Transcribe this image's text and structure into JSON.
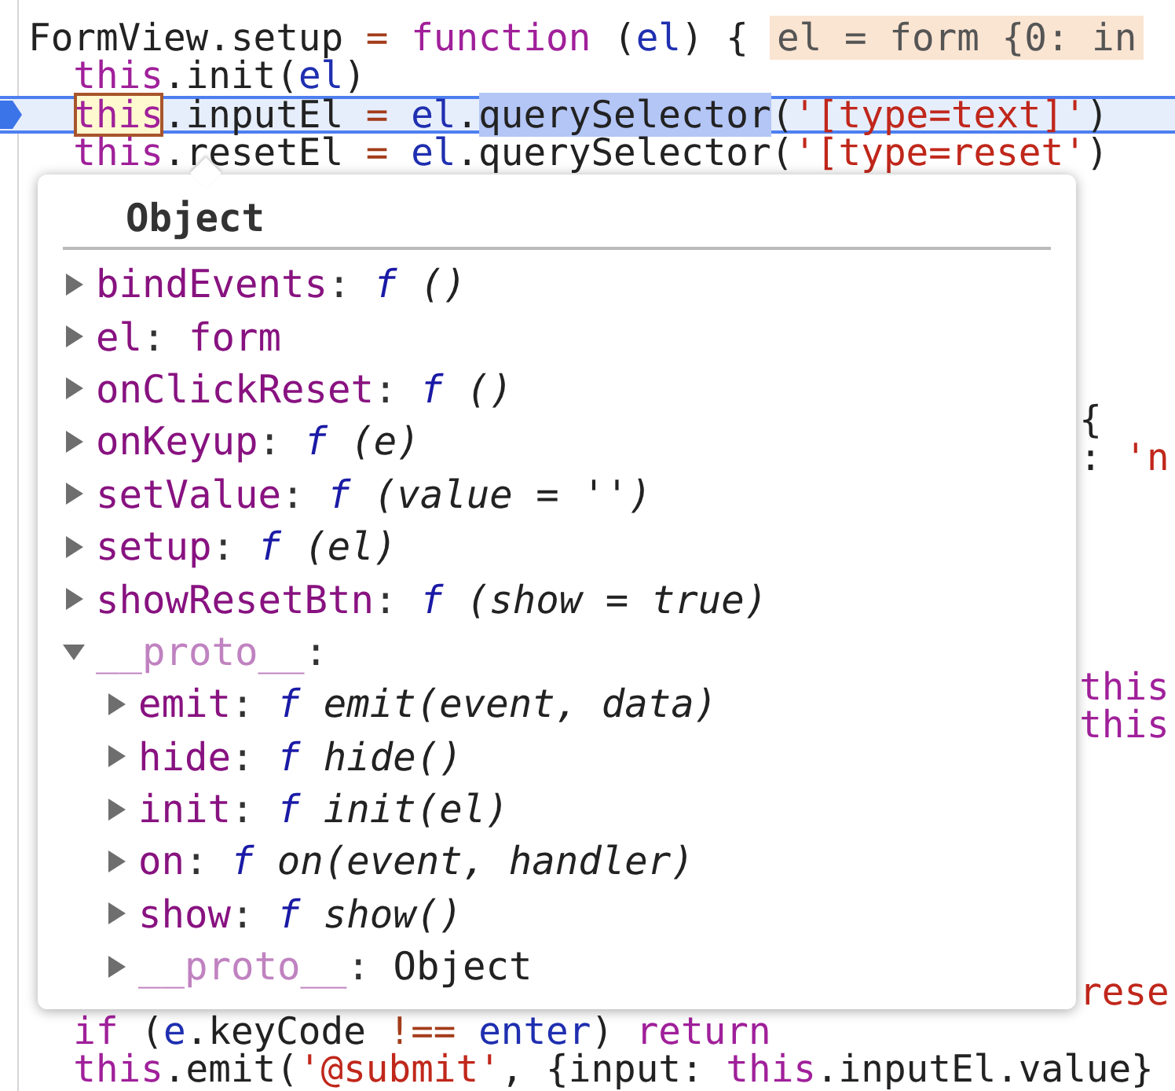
{
  "code_lines": [
    {
      "paused": false,
      "tokens": [
        {
          "kind": "plain",
          "text": "FormView.setup "
        },
        {
          "kind": "operator",
          "text": "= "
        },
        {
          "kind": "keyword",
          "text": "function"
        },
        {
          "kind": "plain",
          "text": " ("
        },
        {
          "kind": "variable",
          "text": "el"
        },
        {
          "kind": "plain",
          "text": ") {"
        }
      ],
      "inline_value": "el = form {0: in"
    },
    {
      "paused": false,
      "tokens": [
        {
          "kind": "keyword",
          "text": "  this"
        },
        {
          "kind": "plain",
          "text": ".init("
        },
        {
          "kind": "variable",
          "text": "el"
        },
        {
          "kind": "plain",
          "text": ")"
        }
      ]
    },
    {
      "paused": true,
      "tokens": [
        {
          "kind": "keyword",
          "text": "  this",
          "hovered": true,
          "selected": false
        },
        {
          "kind": "plain",
          "text": ".inputEl ",
          "hovered": false,
          "selected": false
        },
        {
          "kind": "operator",
          "text": "= ",
          "hovered": false,
          "selected": false
        },
        {
          "kind": "variable",
          "text": "el",
          "hovered": false,
          "selected": false
        },
        {
          "kind": "plain",
          "text": ".",
          "hovered": false,
          "selected": false
        },
        {
          "kind": "plain",
          "text": "querySelector",
          "hovered": false,
          "selected": true
        },
        {
          "kind": "plain",
          "text": "(",
          "hovered": false,
          "selected": false
        },
        {
          "kind": "string",
          "text": "'[type=text]'",
          "hovered": false,
          "selected": false
        },
        {
          "kind": "plain",
          "text": ")",
          "hovered": false,
          "selected": false
        }
      ]
    },
    {
      "paused": false,
      "tokens": [
        {
          "kind": "keyword",
          "text": "  this"
        },
        {
          "kind": "plain",
          "text": ".resetEl "
        },
        {
          "kind": "operator",
          "text": "= "
        },
        {
          "kind": "variable",
          "text": "el"
        },
        {
          "kind": "plain",
          "text": ".querySelector("
        },
        {
          "kind": "string",
          "text": "'[type=reset'"
        },
        {
          "kind": "plain",
          "text": ")"
        }
      ]
    },
    {
      "paused": false
    },
    {
      "paused": false
    },
    {
      "paused": false
    },
    {
      "paused": false
    },
    {
      "paused": false
    },
    {
      "paused": false
    },
    {
      "paused": false,
      "right": [
        {
          "kind": "plain",
          "text": "{"
        }
      ]
    },
    {
      "paused": false,
      "right": [
        {
          "kind": "plain",
          "text": ": "
        },
        {
          "kind": "string",
          "text": "'n"
        }
      ]
    },
    {
      "paused": false
    },
    {
      "paused": false
    },
    {
      "paused": false
    },
    {
      "paused": false
    },
    {
      "paused": false
    },
    {
      "paused": false,
      "right": [
        {
          "kind": "keyword",
          "text": "this"
        }
      ]
    },
    {
      "paused": false,
      "right": [
        {
          "kind": "keyword",
          "text": "this"
        }
      ]
    },
    {
      "paused": false
    },
    {
      "paused": false
    },
    {
      "paused": false
    },
    {
      "paused": false
    },
    {
      "paused": false
    },
    {
      "paused": false
    },
    {
      "paused": false,
      "right": [
        {
          "kind": "string",
          "text": "rese"
        }
      ]
    },
    {
      "paused": false,
      "tokens": [
        {
          "kind": "keyword",
          "text": "  if"
        },
        {
          "kind": "plain",
          "text": " ("
        },
        {
          "kind": "variable",
          "text": "e"
        },
        {
          "kind": "plain",
          "text": ".keyCode "
        },
        {
          "kind": "operator",
          "text": "!== "
        },
        {
          "kind": "variable",
          "text": "enter"
        },
        {
          "kind": "plain",
          "text": ") "
        },
        {
          "kind": "keyword",
          "text": "return"
        }
      ]
    },
    {
      "paused": false,
      "tokens": [
        {
          "kind": "keyword",
          "text": "  this"
        },
        {
          "kind": "plain",
          "text": ".emit("
        },
        {
          "kind": "string",
          "text": "'@submit'"
        },
        {
          "kind": "plain",
          "text": ", {input: "
        },
        {
          "kind": "keyword",
          "text": "this"
        },
        {
          "kind": "plain",
          "text": ".inputEl.value}"
        }
      ]
    }
  ],
  "popover": {
    "title": "Object",
    "items": [
      {
        "key": "bindEvents",
        "separator": ":",
        "kind": "function",
        "marker": "f",
        "value": "()",
        "expanded": false
      },
      {
        "key": "el",
        "separator": ":",
        "kind": "element",
        "value": "form",
        "expanded": false
      },
      {
        "key": "onClickReset",
        "separator": ":",
        "kind": "function",
        "marker": "f",
        "value": "()",
        "expanded": false
      },
      {
        "key": "onKeyup",
        "separator": ":",
        "kind": "function",
        "marker": "f",
        "value": "(e)",
        "expanded": false
      },
      {
        "key": "setValue",
        "separator": ":",
        "kind": "function",
        "marker": "f",
        "value": "(value = '')",
        "expanded": false
      },
      {
        "key": "setup",
        "separator": ":",
        "kind": "function",
        "marker": "f",
        "value": "(el)",
        "expanded": false
      },
      {
        "key": "showResetBtn",
        "separator": ":",
        "kind": "function",
        "marker": "f",
        "value": "(show = true)",
        "expanded": false
      },
      {
        "key": "__proto__",
        "separator": ":",
        "kind": "internal",
        "expanded": true,
        "children": [
          {
            "key": "emit",
            "separator": ":",
            "kind": "function",
            "marker": "f",
            "value": "emit(event, data)",
            "expanded": false
          },
          {
            "key": "hide",
            "separator": ":",
            "kind": "function",
            "marker": "f",
            "value": "hide()",
            "expanded": false
          },
          {
            "key": "init",
            "separator": ":",
            "kind": "function",
            "marker": "f",
            "value": "init(el)",
            "expanded": false
          },
          {
            "key": "on",
            "separator": ":",
            "kind": "function",
            "marker": "f",
            "value": "on(event, handler)",
            "expanded": false
          },
          {
            "key": "show",
            "separator": ":",
            "kind": "function",
            "marker": "f",
            "value": "show()",
            "expanded": false
          },
          {
            "key": "__proto__",
            "separator": ":",
            "kind": "internal",
            "value": "Object",
            "expanded": false
          }
        ]
      }
    ]
  }
}
